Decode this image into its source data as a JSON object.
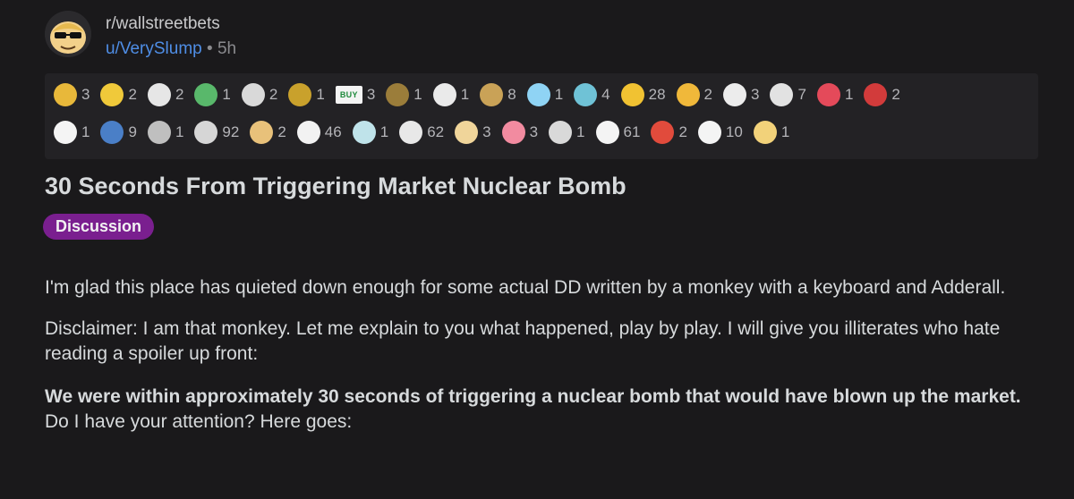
{
  "header": {
    "subreddit": "r/wallstreetbets",
    "username": "u/VerySlump",
    "separator": "•",
    "time": "5h"
  },
  "awards": {
    "row1": [
      {
        "icon": "award-icon",
        "count": "3",
        "color": "#e8b83a"
      },
      {
        "icon": "award-icon",
        "count": "2",
        "color": "#f0c93a"
      },
      {
        "icon": "award-icon",
        "count": "2",
        "color": "#e6e6e6"
      },
      {
        "icon": "award-icon",
        "count": "1",
        "color": "#59b86b"
      },
      {
        "icon": "award-icon",
        "count": "2",
        "color": "#d9d9d9"
      },
      {
        "icon": "award-icon",
        "count": "1",
        "color": "#c9a12c"
      },
      {
        "icon": "buy-icon",
        "count": "3",
        "color": "#f4f4f4",
        "label": "BUY"
      },
      {
        "icon": "award-icon",
        "count": "1",
        "color": "#9b7d3a"
      },
      {
        "icon": "award-icon",
        "count": "1",
        "color": "#eaeaea"
      },
      {
        "icon": "award-icon",
        "count": "8",
        "color": "#c9a257"
      },
      {
        "icon": "award-icon",
        "count": "1",
        "color": "#8fd3f4"
      },
      {
        "icon": "award-icon",
        "count": "4",
        "color": "#6fc2d6"
      },
      {
        "icon": "award-icon",
        "count": "28",
        "color": "#f1c232"
      },
      {
        "icon": "award-icon",
        "count": "2",
        "color": "#f0b83a"
      },
      {
        "icon": "award-icon",
        "count": "3",
        "color": "#ececec"
      },
      {
        "icon": "award-icon",
        "count": "7",
        "color": "#e2e2e2"
      },
      {
        "icon": "award-icon",
        "count": "1",
        "color": "#e44a5a"
      },
      {
        "icon": "award-icon",
        "count": "2",
        "color": "#d23b3b"
      }
    ],
    "row2": [
      {
        "icon": "award-icon",
        "count": "1",
        "color": "#f4f4f4"
      },
      {
        "icon": "award-icon",
        "count": "9",
        "color": "#4a7fc7"
      },
      {
        "icon": "award-icon",
        "count": "1",
        "color": "#bfbfbf"
      },
      {
        "icon": "award-icon",
        "count": "92",
        "color": "#d6d6d6"
      },
      {
        "icon": "award-icon",
        "count": "2",
        "color": "#e8c17a"
      },
      {
        "icon": "award-icon",
        "count": "46",
        "color": "#f2f2f2"
      },
      {
        "icon": "award-icon",
        "count": "1",
        "color": "#bfe3ea"
      },
      {
        "icon": "award-icon",
        "count": "62",
        "color": "#e8e8e8"
      },
      {
        "icon": "award-icon",
        "count": "3",
        "color": "#f0d59a"
      },
      {
        "icon": "award-icon",
        "count": "3",
        "color": "#f28ba0"
      },
      {
        "icon": "award-icon",
        "count": "1",
        "color": "#d9d9d9"
      },
      {
        "icon": "award-icon",
        "count": "61",
        "color": "#f4f4f4"
      },
      {
        "icon": "award-icon",
        "count": "2",
        "color": "#e14b3c"
      },
      {
        "icon": "award-icon",
        "count": "10",
        "color": "#f4f4f4"
      },
      {
        "icon": "award-icon",
        "count": "1",
        "color": "#f2d27a"
      }
    ]
  },
  "post": {
    "title": "30 Seconds From Triggering Market Nuclear Bomb",
    "flair": "Discussion",
    "paragraph1": "I'm glad this place has quieted down enough for some actual DD written by a monkey with a keyboard and Adderall.",
    "paragraph2": "Disclaimer: I am that monkey.  Let me explain to you what happened, play by play.  I will give you illiterates who hate reading a spoiler up front:",
    "paragraph3_bold": "We were within approximately 30 seconds of triggering a nuclear bomb that would have blown up the market.",
    "paragraph3_rest": " Do I have your attention?  Here goes:"
  }
}
